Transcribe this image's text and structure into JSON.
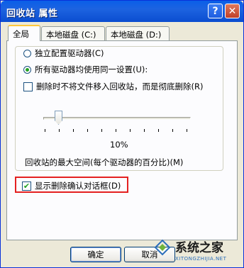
{
  "window": {
    "title": "回收站 属性"
  },
  "titlebar": {
    "help_glyph": "?",
    "close_glyph": "✕"
  },
  "tabs": [
    {
      "label": "全局",
      "active": true
    },
    {
      "label": "本地磁盘 (C:)"
    },
    {
      "label": "本地磁盘 (D:)"
    }
  ],
  "options": {
    "radio_independent": "独立配置驱动器(C)",
    "radio_all_same": "所有驱动器均使用同一设置(U):",
    "check_delete_permanent": "删除时不将文件移入回收站，而是彻底删除(R)",
    "slider_value": "10%",
    "slider_level": 0.1,
    "slider_caption": "回收站的最大空间(每个驱动器的百分比)(M)",
    "check_confirm_dialog": "显示删除确认对话框(D)",
    "confirm_checked": true,
    "permanent_checked": false
  },
  "buttons": {
    "ok": "确定",
    "cancel": "取消"
  },
  "watermark": {
    "name": "系统之家",
    "url": "XITONGZHIJIA.NET"
  },
  "colors": {
    "title_bar": "#0a5fe8",
    "highlight_box": "#e42020",
    "check_green": "#21a121"
  }
}
